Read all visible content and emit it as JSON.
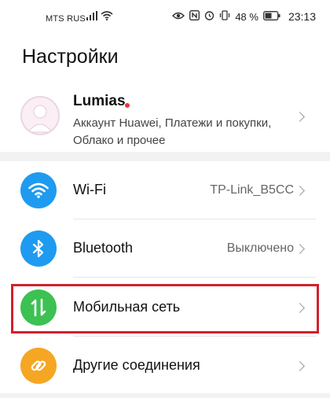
{
  "status_bar": {
    "carrier": "MTS RUS",
    "battery_percent": "48 %",
    "time": "23:13"
  },
  "page": {
    "title": "Настройки"
  },
  "account": {
    "name": "Lumias",
    "subtitle": "Аккаунт Huawei, Платежи и покупки, Облако и прочее"
  },
  "rows": [
    {
      "label": "Wi-Fi",
      "value": "TP-Link_B5CC",
      "color": "#1e9bf0",
      "icon": "wifi-icon"
    },
    {
      "label": "Bluetooth",
      "value": "Выключено",
      "color": "#1e9bf0",
      "icon": "bluetooth-icon"
    },
    {
      "label": "Мобильная сеть",
      "value": "",
      "color": "#3cc152",
      "icon": "mobile-data-icon"
    },
    {
      "label": "Другие соединения",
      "value": "",
      "color": "#f5a623",
      "icon": "link-icon"
    }
  ],
  "highlight_color": "#d2202e"
}
